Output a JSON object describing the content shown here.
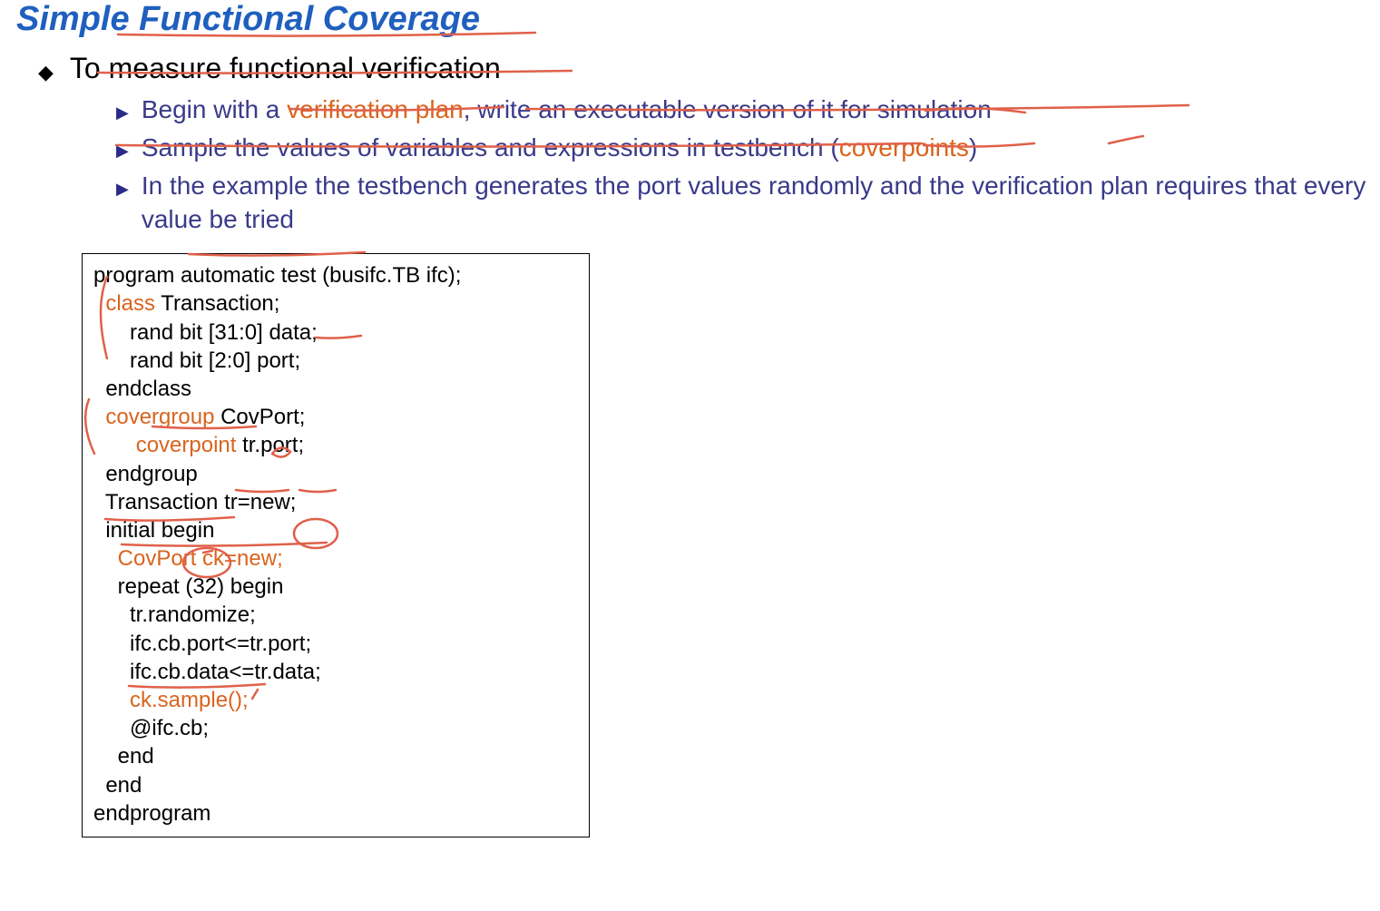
{
  "title": "Simple Functional Coverage",
  "main_bullet": "To measure functional verification",
  "sub_items": [
    {
      "pre": "Begin with a ",
      "hl1": "verification plan",
      "mid": ", write an executable version of it for simulation",
      "hl2": "",
      "post": ""
    },
    {
      "pre": "Sample the values of variables and expressions in testbench (",
      "hl1": "coverpoints",
      "mid": ")",
      "hl2": "",
      "post": ""
    },
    {
      "pre": "In the example the testbench generates the port values randomly and the verification plan requires that every value be tried",
      "hl1": "",
      "mid": "",
      "hl2": "",
      "post": ""
    }
  ],
  "code": {
    "l1a": "program automatic test (busifc.TB ifc);",
    "l2_pre": "  ",
    "l2_kw": "class",
    "l2_post": " Transaction;",
    "l3": "      rand bit [31:0] data;",
    "l4": "      rand bit [2:0] port;",
    "l5": "  endclass",
    "l6_pre": "  ",
    "l6_kw": "covergroup",
    "l6_post": " CovPort;",
    "l7_pre": "       ",
    "l7_kw": "coverpoint",
    "l7_post": " tr.port;",
    "l8": "  endgroup",
    "l9": "  Transaction tr=new;",
    "l10": "  initial begin",
    "l11_pre": "    ",
    "l11_kw": "CovPort ck=new;",
    "l12": "    repeat (32) begin",
    "l13": "      tr.randomize;",
    "l14": "      ifc.cb.port<=tr.port;",
    "l15": "      ifc.cb.data<=tr.data;",
    "l16_pre": "      ",
    "l16_kw": "ck.sample();",
    "l17": "      @ifc.cb;",
    "l18": "    end",
    "l19": "  end",
    "l20": "endprogram"
  }
}
